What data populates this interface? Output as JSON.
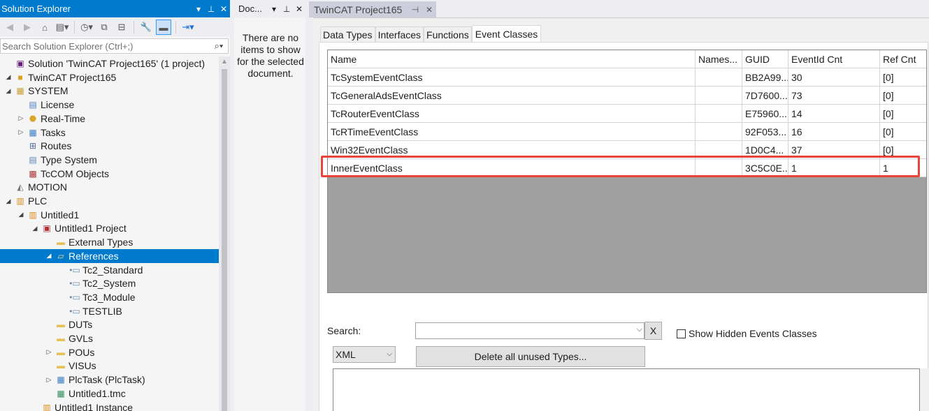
{
  "solution_explorer": {
    "title": "Solution Explorer",
    "search_placeholder": "Search Solution Explorer (Ctrl+;)",
    "tree": [
      {
        "label": "Solution 'TwinCAT Project165' (1 project)",
        "icon": "solution-icon",
        "depth": 0,
        "expand": ""
      },
      {
        "label": "TwinCAT Project165",
        "icon": "twincat-project-icon",
        "depth": 0,
        "expand": "◢"
      },
      {
        "label": "SYSTEM",
        "icon": "system-icon",
        "depth": 1,
        "expand": "◢"
      },
      {
        "label": "License",
        "icon": "license-icon",
        "depth": 2,
        "expand": ""
      },
      {
        "label": "Real-Time",
        "icon": "realtime-icon",
        "depth": 2,
        "expand": "▷"
      },
      {
        "label": "Tasks",
        "icon": "tasks-icon",
        "depth": 2,
        "expand": "▷"
      },
      {
        "label": "Routes",
        "icon": "routes-icon",
        "depth": 2,
        "expand": ""
      },
      {
        "label": "Type System",
        "icon": "type-system-icon",
        "depth": 2,
        "expand": ""
      },
      {
        "label": "TcCOM Objects",
        "icon": "tccom-icon",
        "depth": 2,
        "expand": ""
      },
      {
        "label": "MOTION",
        "icon": "motion-icon",
        "depth": 1,
        "expand": ""
      },
      {
        "label": "PLC",
        "icon": "plc-icon",
        "depth": 1,
        "expand": "◢"
      },
      {
        "label": "Untitled1",
        "icon": "plc-project-icon",
        "depth": 2,
        "expand": "◢"
      },
      {
        "label": "Untitled1 Project",
        "icon": "plc-project-sub-icon",
        "depth": 3,
        "expand": "◢"
      },
      {
        "label": "External Types",
        "icon": "folder-icon",
        "depth": 4,
        "expand": ""
      },
      {
        "label": "References",
        "icon": "folder-open-icon",
        "depth": 4,
        "expand": "◢",
        "selected": true
      },
      {
        "label": "Tc2_Standard",
        "icon": "library-reference-icon",
        "depth": 5,
        "expand": ""
      },
      {
        "label": "Tc2_System",
        "icon": "library-reference-icon",
        "depth": 5,
        "expand": ""
      },
      {
        "label": "Tc3_Module",
        "icon": "library-reference-icon",
        "depth": 5,
        "expand": ""
      },
      {
        "label": "TESTLIB",
        "icon": "library-reference-icon",
        "depth": 5,
        "expand": ""
      },
      {
        "label": "DUTs",
        "icon": "folder-icon",
        "depth": 4,
        "expand": ""
      },
      {
        "label": "GVLs",
        "icon": "folder-icon",
        "depth": 4,
        "expand": ""
      },
      {
        "label": "POUs",
        "icon": "folder-icon",
        "depth": 4,
        "expand": "▷"
      },
      {
        "label": "VISUs",
        "icon": "folder-icon",
        "depth": 4,
        "expand": ""
      },
      {
        "label": "PlcTask (PlcTask)",
        "icon": "plc-task-icon",
        "depth": 4,
        "expand": "▷"
      },
      {
        "label": "Untitled1.tmc",
        "icon": "tmc-file-icon",
        "depth": 4,
        "expand": ""
      },
      {
        "label": "Untitled1 Instance",
        "icon": "plc-instance-icon",
        "depth": 3,
        "expand": ""
      }
    ]
  },
  "document_outline": {
    "title": "Doc...",
    "message": "There are no items to show for the selected document."
  },
  "editor": {
    "tab_title": "TwinCAT Project165",
    "tabs": [
      "Data Types",
      "Interfaces",
      "Functions",
      "Event Classes"
    ],
    "active_tab": 3,
    "columns": [
      "Name",
      "Names...",
      "GUID",
      "EventId Cnt",
      "Ref Cnt"
    ],
    "rows": [
      [
        "TcSystemEventClass",
        "",
        "BB2A99...",
        "30",
        "[0]"
      ],
      [
        "TcGeneralAdsEventClass",
        "",
        "7D7600...",
        "73",
        "[0]"
      ],
      [
        "TcRouterEventClass",
        "",
        "E75960...",
        "14",
        "[0]"
      ],
      [
        "TcRTimeEventClass",
        "",
        "92F053...",
        "16",
        "[0]"
      ],
      [
        "Win32EventClass",
        "",
        "1D0C4...",
        "37",
        "[0]"
      ],
      [
        "InnerEventClass",
        "",
        "3C5C0E...",
        "1",
        "1"
      ]
    ],
    "highlighted_row": 5,
    "search_label": "Search:",
    "search_value": "",
    "clear_label": "X",
    "show_hidden_label": "Show Hidden Events Classes",
    "show_hidden_checked": false,
    "format_select": "XML",
    "delete_unused_label": "Delete all unused Types..."
  },
  "colors": {
    "accent": "#007acc",
    "highlight_border": "#e8443a",
    "grid_empty": "#a0a0a0"
  }
}
